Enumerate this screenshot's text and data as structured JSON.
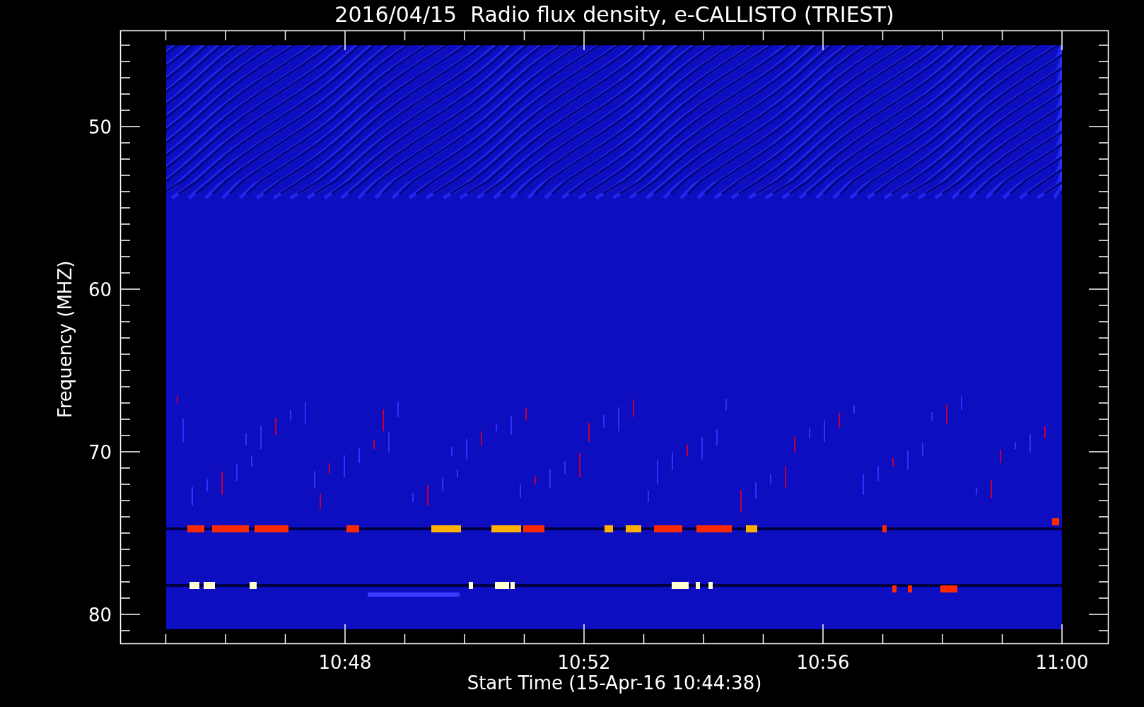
{
  "plot": {
    "title": "2016/04/15  Radio flux density, e-CALLISTO (TRIEST)",
    "xlabel": "Start Time (15-Apr-16 10:44:38)",
    "ylabel": "Frequency (MHZ)",
    "yticks": [
      "50",
      "60",
      "70",
      "80"
    ],
    "xticks": [
      "10:48",
      "10:52",
      "10:56",
      "11:00"
    ]
  }
}
